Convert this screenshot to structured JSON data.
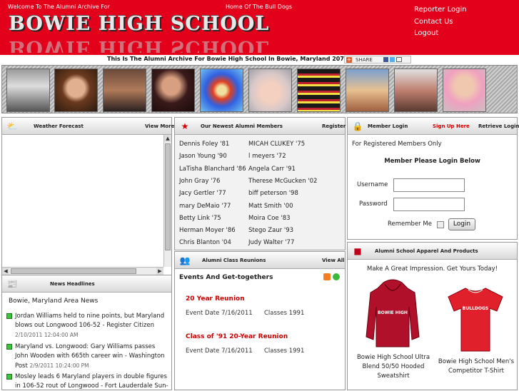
{
  "header": {
    "welcome": "Welcome To The Alumni Archive For",
    "home": "Home Of The Bull Dogs",
    "logo_text": "BOWIE HIGH SCHOOL",
    "links": [
      "Reporter Login",
      "Contact Us",
      "Logout"
    ],
    "tagline": "This Is The Alumni Archive For Bowie High School In Bowie, Maryland 20715",
    "share_label": "SHARE"
  },
  "weather": {
    "title": "Weather Forecast",
    "link": "View More"
  },
  "news": {
    "title": "News Headlines",
    "subtitle": "Bowie, Maryland Area News",
    "items": [
      {
        "text": "Jordan Williams held to nine points, but Maryland blows out Longwood 106-52 - Register Citizen",
        "date": "2/10/2011 12:04:00 AM"
      },
      {
        "text": "Maryland vs. Longwood: Gary Williams passes John Wooden with 665th career win - Washington Post",
        "date": "2/9/2011 10:24:00 PM"
      },
      {
        "text": "Mosley leads 6 Maryland players in double figures in 106-52 rout of Longwood - Fort Lauderdale Sun-",
        "date": ""
      }
    ]
  },
  "members": {
    "title": "Our Newest Alumni Members",
    "link": "Register",
    "left": [
      "Dennis Foley '81",
      "Jason Young '90",
      "LaTisha Blanchard '86",
      "John Gray '76",
      "Jacy Gertler '77",
      "mary DeMaio '77",
      "Betty Link '75",
      "Herman Moyer '86",
      "Chris Blanton '04"
    ],
    "right": [
      "MICAH CLUKEY '75",
      "l meyers '72",
      "Angela Carr '91",
      "Therese McGucken '02",
      "biff peterson '98",
      "Matt Smith '00",
      "Moira Coe '83",
      "Stego Zaur '93",
      "Judy Walter '77"
    ]
  },
  "reunions": {
    "title": "Alumni Class Reunions",
    "link": "View All",
    "events_title": "Events And Get-togethers",
    "events": [
      {
        "name": "20 Year Reunion",
        "date": "Event Date 7/16/2011",
        "class": "Classes 1991"
      },
      {
        "name": "Class of '91 20-Year Reunion",
        "date": "Event Date 7/16/2011",
        "class": "Classes 1991"
      }
    ]
  },
  "login": {
    "title": "Member Login",
    "signup": "Sign Up Here",
    "retrieve": "Retrieve Login",
    "note": "For Registered Members Only",
    "heading": "Member Please Login Below",
    "username_label": "Username",
    "password_label": "Password",
    "remember_label": "Remember Me",
    "button": "Login"
  },
  "apparel": {
    "title": "Alumni School Apparel And Products",
    "tagline": "Make A Great Impression. Get Yours Today!",
    "products": [
      {
        "name": "Bowie High School Ultra Blend 50/50 Hooded Sweatshirt",
        "print": "BOWIE HIGH"
      },
      {
        "name": "Bowie High School Men's Competitor T-Shirt",
        "print": "BULLDOGS"
      }
    ]
  },
  "colors": {
    "brand_red": "#e2001b",
    "accent_red": "#cc0000",
    "bullet_green": "#3cc43c"
  },
  "icons": [
    "share-icon",
    "weather-icon",
    "news-icon",
    "star-icon",
    "people-icon",
    "lock-icon",
    "shirt-icon",
    "rss-icon",
    "add-icon"
  ]
}
